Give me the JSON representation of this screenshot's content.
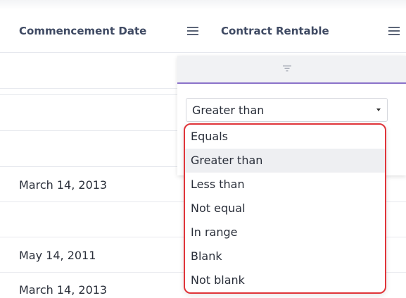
{
  "columns": {
    "commencement": {
      "title": "Commencement Date"
    },
    "rentable": {
      "title": "Contract Rentable"
    }
  },
  "rows": [
    {
      "date": ""
    },
    {
      "date": ""
    },
    {
      "date": ""
    },
    {
      "date": "March 14, 2013"
    },
    {
      "date": ""
    },
    {
      "date": "May 14, 2011"
    },
    {
      "date": "March 14, 2013"
    }
  ],
  "filter": {
    "tab_icon": "filter-icon",
    "operator_selected": "Greater than",
    "options": [
      {
        "label": "Equals"
      },
      {
        "label": "Greater than"
      },
      {
        "label": "Less than"
      },
      {
        "label": "Not equal"
      },
      {
        "label": "In range"
      },
      {
        "label": "Blank"
      },
      {
        "label": "Not blank"
      }
    ]
  },
  "colors": {
    "header_text": "#3f4a63",
    "tab_underline": "#8a72c9",
    "highlight_border": "#e0353a",
    "selected_option_bg": "#eeeff2"
  }
}
